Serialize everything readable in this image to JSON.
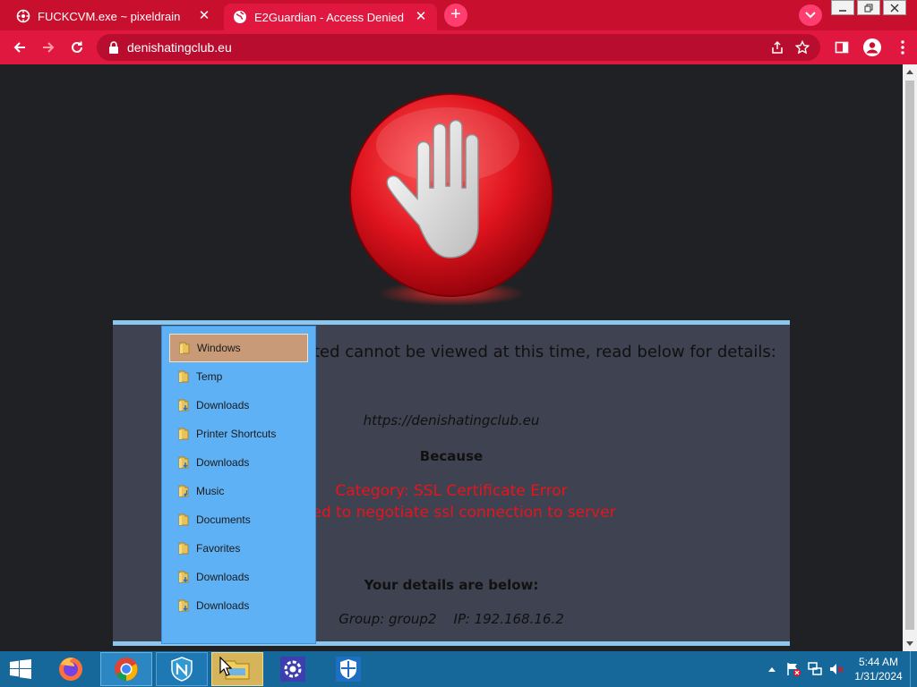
{
  "browser": {
    "tabs": [
      {
        "title": "FUCKCVM.exe ~ pixeldrain",
        "active": false
      },
      {
        "title": "E2Guardian - Access Denied",
        "active": true
      }
    ],
    "new_tab_label": "+",
    "url": "denishatingclub.eu"
  },
  "page": {
    "heading": "The site requested cannot be viewed at this time, read below for details:",
    "blocked_url": "https://denishatingclub.eu",
    "because_label": "Because",
    "reason_category": "Category: SSL Certificate Error",
    "reason_detail": "Failed to negotiate ssl connection to server",
    "details_heading": "Your details are below:",
    "details_line": "Group: group2    IP: 192.168.16.2"
  },
  "folder_menu": {
    "items": [
      {
        "label": "Windows",
        "selected": true
      },
      {
        "label": "Temp",
        "selected": false
      },
      {
        "label": "Downloads",
        "selected": false
      },
      {
        "label": "Printer Shortcuts",
        "selected": false
      },
      {
        "label": "Downloads",
        "selected": false
      },
      {
        "label": "Music",
        "selected": false
      },
      {
        "label": "Documents",
        "selected": false
      },
      {
        "label": "Favorites",
        "selected": false
      },
      {
        "label": "Downloads",
        "selected": false
      },
      {
        "label": "Downloads",
        "selected": false
      }
    ]
  },
  "taskbar": {
    "apps": [
      "firefox-icon",
      "chrome-icon",
      "nextdns-icon",
      "file-explorer-icon",
      "settings-icon",
      "defender-icon"
    ],
    "clock_time": "5:44 AM",
    "clock_date": "1/31/2024"
  },
  "colors": {
    "browser_frame": "#c8102e",
    "panel_border": "#8cc7f0",
    "panel_bg": "#3f4250",
    "error_text": "#e8141c",
    "folder_menu_bg": "#5fb1f5",
    "taskbar_bg": "#16679a"
  }
}
